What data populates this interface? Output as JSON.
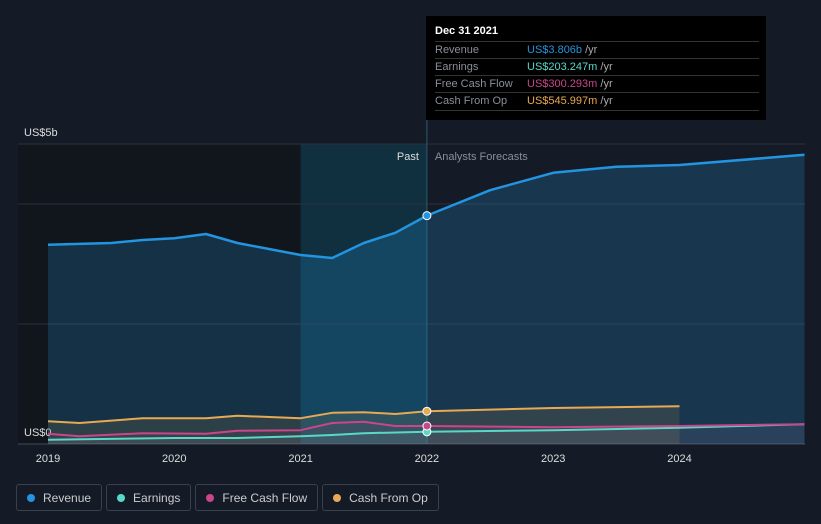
{
  "chart_data": {
    "type": "line",
    "y_axis_labels": [
      "US$5b",
      "US$0"
    ],
    "ylim": [
      0,
      5
    ],
    "xlim": [
      2018.8,
      2025
    ],
    "x_ticks": [
      "2019",
      "2020",
      "2021",
      "2022",
      "2023",
      "2024"
    ],
    "past_label": "Past",
    "forecast_label": "Analysts Forecasts",
    "series": [
      {
        "name": "Revenue",
        "color": "#2394df",
        "points": [
          [
            2019,
            3.32
          ],
          [
            2019.5,
            3.35
          ],
          [
            2019.75,
            3.4
          ],
          [
            2020,
            3.43
          ],
          [
            2020.25,
            3.5
          ],
          [
            2020.5,
            3.35
          ],
          [
            2020.75,
            3.25
          ],
          [
            2021,
            3.15
          ],
          [
            2021.25,
            3.1
          ],
          [
            2021.5,
            3.35
          ],
          [
            2021.75,
            3.52
          ],
          [
            2022,
            3.806
          ],
          [
            2022.5,
            4.23
          ],
          [
            2023,
            4.52
          ],
          [
            2023.5,
            4.62
          ],
          [
            2024,
            4.65
          ],
          [
            2024.99,
            4.82
          ]
        ]
      },
      {
        "name": "Earnings",
        "color": "#58d8c8",
        "points": [
          [
            2019,
            0.07
          ],
          [
            2020,
            0.1
          ],
          [
            2020.5,
            0.1
          ],
          [
            2021,
            0.13
          ],
          [
            2021.25,
            0.15
          ],
          [
            2021.5,
            0.18
          ],
          [
            2022,
            0.203
          ],
          [
            2023,
            0.23
          ],
          [
            2024,
            0.27
          ],
          [
            2024.99,
            0.33
          ]
        ]
      },
      {
        "name": "Free Cash Flow",
        "color": "#c9468a",
        "points": [
          [
            2019,
            0.17
          ],
          [
            2019.25,
            0.13
          ],
          [
            2019.75,
            0.18
          ],
          [
            2020.25,
            0.17
          ],
          [
            2020.5,
            0.22
          ],
          [
            2021,
            0.23
          ],
          [
            2021.25,
            0.35
          ],
          [
            2021.5,
            0.37
          ],
          [
            2021.75,
            0.3
          ],
          [
            2022,
            0.3
          ],
          [
            2023,
            0.28
          ],
          [
            2024,
            0.3
          ],
          [
            2024.99,
            0.33
          ]
        ]
      },
      {
        "name": "Cash From Op",
        "color": "#e8a954",
        "points": [
          [
            2019,
            0.38
          ],
          [
            2019.25,
            0.35
          ],
          [
            2019.75,
            0.43
          ],
          [
            2020.25,
            0.43
          ],
          [
            2020.5,
            0.47
          ],
          [
            2021,
            0.43
          ],
          [
            2021.25,
            0.52
          ],
          [
            2021.5,
            0.53
          ],
          [
            2021.75,
            0.5
          ],
          [
            2022,
            0.546
          ],
          [
            2023,
            0.6
          ],
          [
            2024,
            0.63
          ]
        ]
      }
    ]
  },
  "tooltip": {
    "date": "Dec 31 2021",
    "rows": [
      {
        "label": "Revenue",
        "value": "US$3.806b",
        "unit": " /yr",
        "color": "#2394df"
      },
      {
        "label": "Earnings",
        "value": "US$203.247m",
        "unit": " /yr",
        "color": "#58d8c8"
      },
      {
        "label": "Free Cash Flow",
        "value": "US$300.293m",
        "unit": " /yr",
        "color": "#c9468a"
      },
      {
        "label": "Cash From Op",
        "value": "US$545.997m",
        "unit": " /yr",
        "color": "#e8a954"
      }
    ]
  },
  "legend": [
    {
      "label": "Revenue",
      "color": "#2394df"
    },
    {
      "label": "Earnings",
      "color": "#58d8c8"
    },
    {
      "label": "Free Cash Flow",
      "color": "#c9468a"
    },
    {
      "label": "Cash From Op",
      "color": "#e8a954"
    }
  ]
}
